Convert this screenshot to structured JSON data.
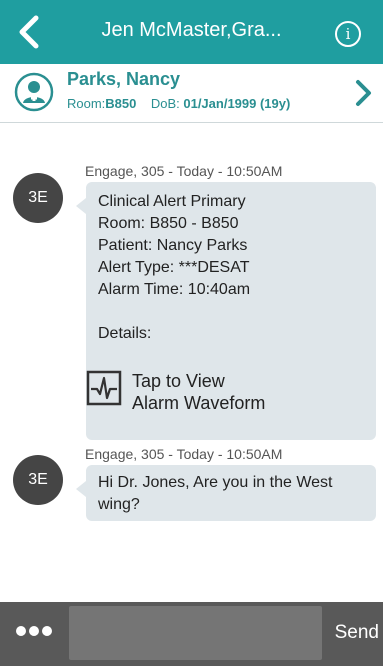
{
  "header": {
    "title": "Jen McMaster,Gra...",
    "back_icon": "chevron-left-icon",
    "info_icon": "info-icon",
    "info_glyph": "i",
    "color": "#1f9ea0"
  },
  "patient": {
    "name": "Parks, Nancy",
    "room_label": "Room:",
    "room": "B850",
    "dob_label": "DoB:",
    "dob": "01/Jan/1999 (19y)",
    "avatar_icon": "patient-avatar-icon",
    "chevron_icon": "chevron-right-icon"
  },
  "messages": [
    {
      "avatar": "3E",
      "meta": "Engage, 305 - Today - 10:50AM",
      "lines": [
        "Clinical Alert Primary",
        "Room: B850 - B850",
        "Patient: Nancy Parks",
        "Alert Type: ***DESAT",
        "Alarm Time: 10:40am",
        "",
        "Details:"
      ],
      "waveform": {
        "icon": "waveform-icon",
        "line1": "Tap to View",
        "line2": "Alarm Waveform"
      }
    },
    {
      "avatar": "3E",
      "meta": "Engage, 305 - Today - 10:50AM",
      "lines": [
        "Hi Dr. Jones, Are you in the West",
        "wing?"
      ]
    }
  ],
  "composer": {
    "more_icon": "more-dots-icon",
    "input_value": "",
    "send_label": "Send"
  }
}
